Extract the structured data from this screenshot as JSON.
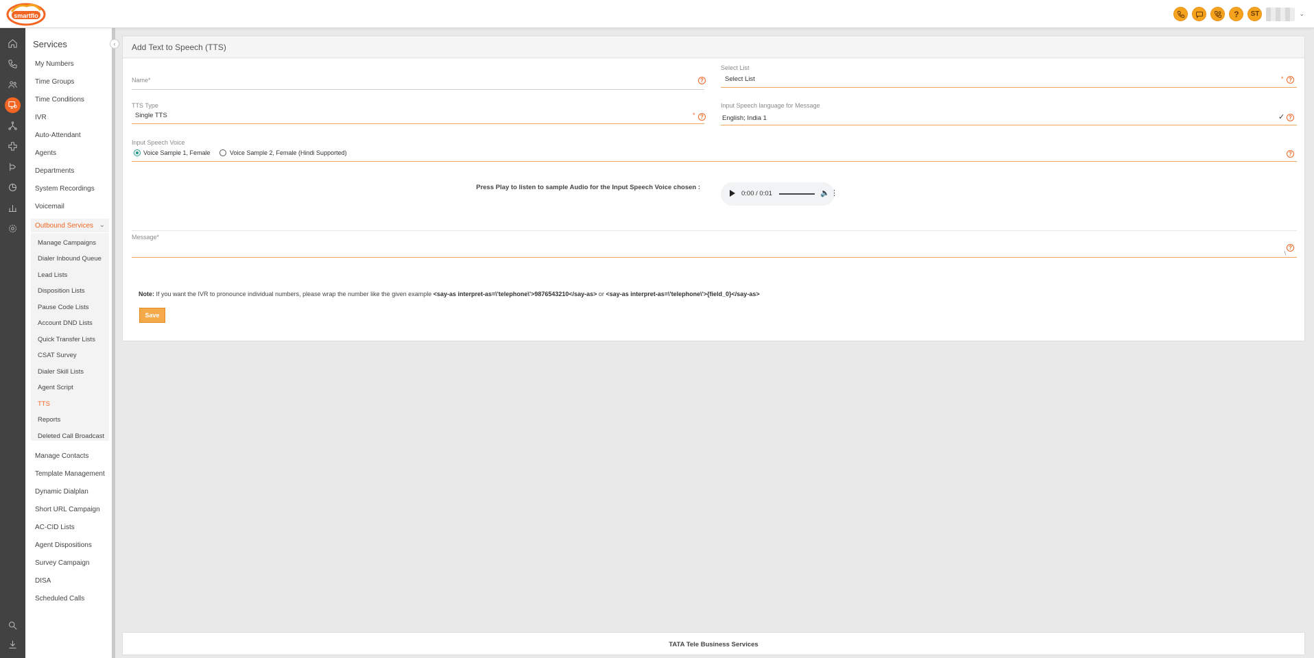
{
  "topbar": {
    "logo_text": "smartflo",
    "avatar_initials": "ST",
    "icons": [
      "phone-icon",
      "sms-icon",
      "call-settings-icon",
      "help-icon"
    ]
  },
  "rail": {
    "icons": [
      "home-icon",
      "phone-icon",
      "users-icon",
      "services-icon",
      "network-icon",
      "integrations-icon",
      "routing-icon",
      "reports-pie-icon",
      "bar-chart-icon",
      "settings-icon",
      "search-icon",
      "download-icon"
    ]
  },
  "services": {
    "title": "Services",
    "items": [
      {
        "label": "My Numbers"
      },
      {
        "label": "Time Groups"
      },
      {
        "label": "Time Conditions"
      },
      {
        "label": "IVR"
      },
      {
        "label": "Auto-Attendant"
      },
      {
        "label": "Agents"
      },
      {
        "label": "Departments"
      },
      {
        "label": "System Recordings"
      },
      {
        "label": "Voicemail"
      }
    ],
    "outbound": {
      "label": "Outbound Services",
      "subitems": [
        {
          "label": "Manage Campaigns"
        },
        {
          "label": "Dialer Inbound Queue"
        },
        {
          "label": "Lead Lists"
        },
        {
          "label": "Disposition Lists"
        },
        {
          "label": "Pause Code Lists"
        },
        {
          "label": "Account DND Lists"
        },
        {
          "label": "Quick Transfer Lists"
        },
        {
          "label": "CSAT Survey"
        },
        {
          "label": "Dialer Skill Lists"
        },
        {
          "label": "Agent Script"
        },
        {
          "label": "TTS"
        },
        {
          "label": "Reports"
        },
        {
          "label": "Deleted Call Broadcast"
        }
      ]
    },
    "items_after": [
      {
        "label": "Manage Contacts"
      },
      {
        "label": "Template Management"
      },
      {
        "label": "Dynamic Dialplan"
      },
      {
        "label": "Short URL Campaign"
      },
      {
        "label": "AC-CID Lists"
      },
      {
        "label": "Agent Dispositions"
      },
      {
        "label": "Survey Campaign"
      },
      {
        "label": "DISA"
      },
      {
        "label": "Scheduled Calls"
      }
    ]
  },
  "form": {
    "title": "Add Text to Speech (TTS)",
    "name_label": "Name*",
    "name_value": "",
    "select_list_label": "Select List",
    "select_list_value": "Select List",
    "tts_type_label": "TTS Type",
    "tts_type_value": "Single TTS",
    "language_label": "Input Speech language for Message",
    "language_value": "English; India 1",
    "voice_label": "Input Speech Voice",
    "voice_options": [
      {
        "label": "Voice Sample 1, Female",
        "selected": true
      },
      {
        "label": "Voice Sample 2, Female (Hindi Supported)",
        "selected": false
      }
    ],
    "audio_caption": "Press Play to listen to sample Audio for the Input Speech Voice chosen :",
    "audio_time": "0:00 / 0:01",
    "message_label": "Message*",
    "message_value": "",
    "note_prefix": "Note:",
    "note_text": " If you want the IVR to pronounce individual numbers, please wrap the number like the given example ",
    "note_example1": "<say-as interpret-as=\\'telephone\\'>9876543210</say-as>",
    "note_or": " or ",
    "note_example2": "<say-as interpret-as=\\'telephone\\'>{field_0}</say-as>",
    "save_label": "Save",
    "required_mark": "*",
    "help_glyph": "?"
  },
  "footer": {
    "text": "TATA Tele Business Services"
  },
  "colors": {
    "accent": "#f26522",
    "button": "#f5a94a",
    "rail": "#424242",
    "radio_on": "#1a9c8c"
  }
}
